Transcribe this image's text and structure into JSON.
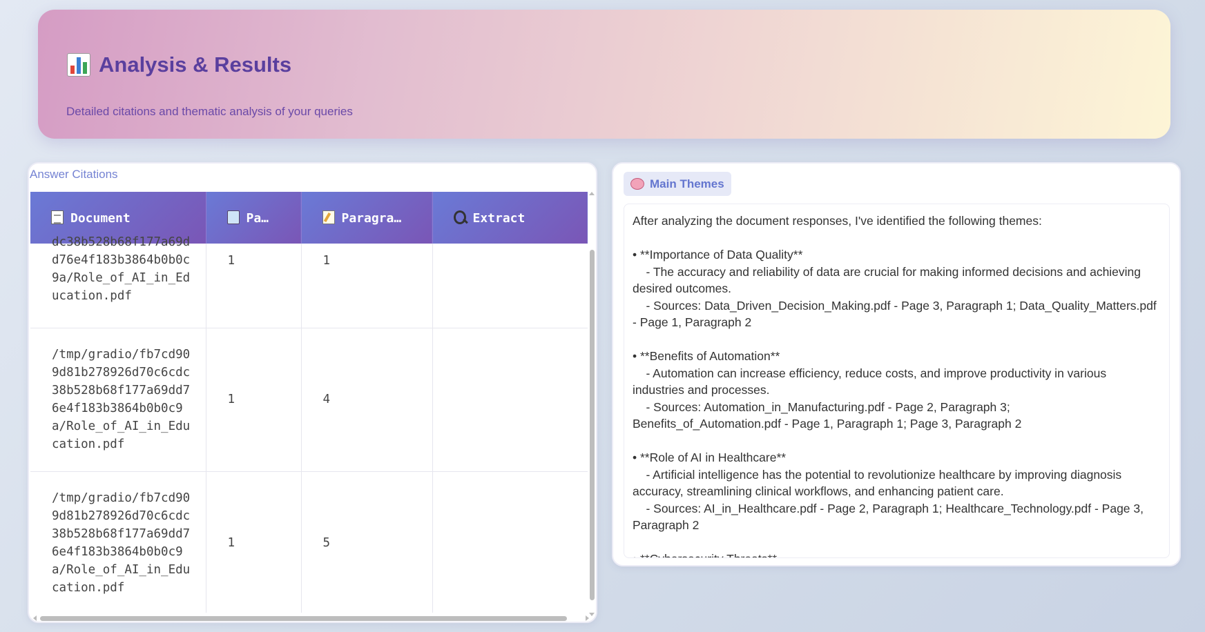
{
  "header": {
    "title": "Analysis & Results",
    "title_icon": "bar-chart-icon",
    "subtitle": "Detailed citations and thematic analysis of your queries"
  },
  "citations": {
    "label": "Answer Citations",
    "columns": [
      {
        "icon": "document-icon",
        "label": "Document"
      },
      {
        "icon": "book-icon",
        "label": "Pa…"
      },
      {
        "icon": "memo-icon",
        "label": "Paragra…"
      },
      {
        "icon": "magnifier-icon",
        "label": "Extract"
      }
    ],
    "rows": [
      {
        "document": "dc38b528b68f177a69dd76e4f183b3864b0b0c9a/Role_of_AI_in_Education.pdf",
        "page": "1",
        "paragraph": "1",
        "extract": ""
      },
      {
        "document": "/tmp/gradio/fb7cd909d81b278926d70c6cdc38b528b68f177a69dd76e4f183b3864b0b0c9a/Role_of_AI_in_Education.pdf",
        "page": "1",
        "paragraph": "4",
        "extract": ""
      },
      {
        "document": "/tmp/gradio/fb7cd909d81b278926d70c6cdc38b528b68f177a69dd76e4f183b3864b0b0c9a/Role_of_AI_in_Education.pdf",
        "page": "1",
        "paragraph": "5",
        "extract": ""
      }
    ]
  },
  "themes": {
    "tag_icon": "brain-icon",
    "tag_label": "Main Themes",
    "text": "After analyzing the document responses, I've identified the following themes:\n\n• **Importance of Data Quality**\n    - The accuracy and reliability of data are crucial for making informed decisions and achieving desired outcomes.\n    - Sources: Data_Driven_Decision_Making.pdf - Page 3, Paragraph 1; Data_Quality_Matters.pdf - Page 1, Paragraph 2\n\n• **Benefits of Automation**\n    - Automation can increase efficiency, reduce costs, and improve productivity in various industries and processes.\n    - Sources: Automation_in_Manufacturing.pdf - Page 2, Paragraph 3; Benefits_of_Automation.pdf - Page 1, Paragraph 1; Page 3, Paragraph 2\n\n• **Role of AI in Healthcare**\n    - Artificial intelligence has the potential to revolutionize healthcare by improving diagnosis accuracy, streamlining clinical workflows, and enhancing patient care.\n    - Sources: AI_in_Healthcare.pdf - Page 2, Paragraph 1; Healthcare_Technology.pdf - Page 3, Paragraph 2\n\n• **Cybersecurity Threats**"
  }
}
